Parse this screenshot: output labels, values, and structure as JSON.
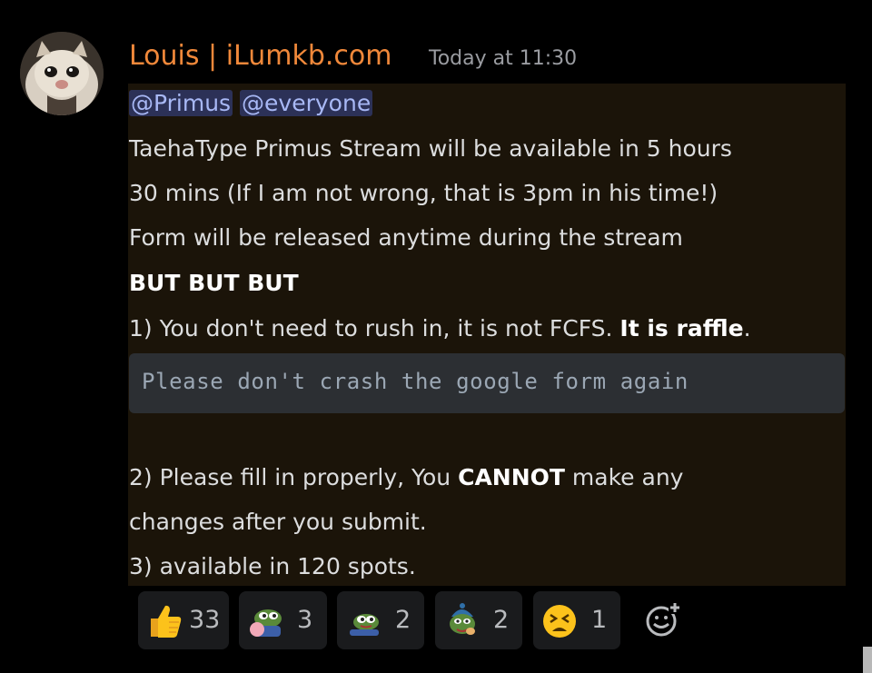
{
  "author": {
    "name": "Louis | iLumkb.com",
    "timestamp": "Today at 11:30",
    "avatar_icon": "cat-avatar"
  },
  "message": {
    "mentions": [
      "@Primus",
      "@everyone"
    ],
    "line1": "TaehaType Primus Stream will be available in 5 hours",
    "line2": "30 mins (If I am not wrong, that is 3pm in his time!)",
    "line3": "Form will be released anytime during the stream",
    "line4_bold": "BUT BUT BUT",
    "item1_prefix": "1) You don't need to rush in, it is not FCFS. ",
    "item1_bold": "It is raffle",
    "item1_suffix": ".",
    "code": "Please don't crash the google form again",
    "item2_prefix": "2) Please fill in properly, You ",
    "item2_bold": "CANNOT",
    "item2_suffix": " make any",
    "item2_line2": "changes after you submit.",
    "item3": "3) available in 120 spots."
  },
  "reactions": [
    {
      "icon": "thumbs-up-icon",
      "count": "33"
    },
    {
      "icon": "pepe-hug-icon",
      "count": "3"
    },
    {
      "icon": "pepe-lying-icon",
      "count": "2"
    },
    {
      "icon": "pepe-beanie-icon",
      "count": "2"
    },
    {
      "icon": "tired-face-icon",
      "count": "1"
    }
  ],
  "colors": {
    "author": "#f0883a",
    "mention_bg": "#2c3157",
    "mention_text": "#a8b8f5",
    "highlight_bg": "#1b1409",
    "code_bg": "#2c2f33"
  }
}
